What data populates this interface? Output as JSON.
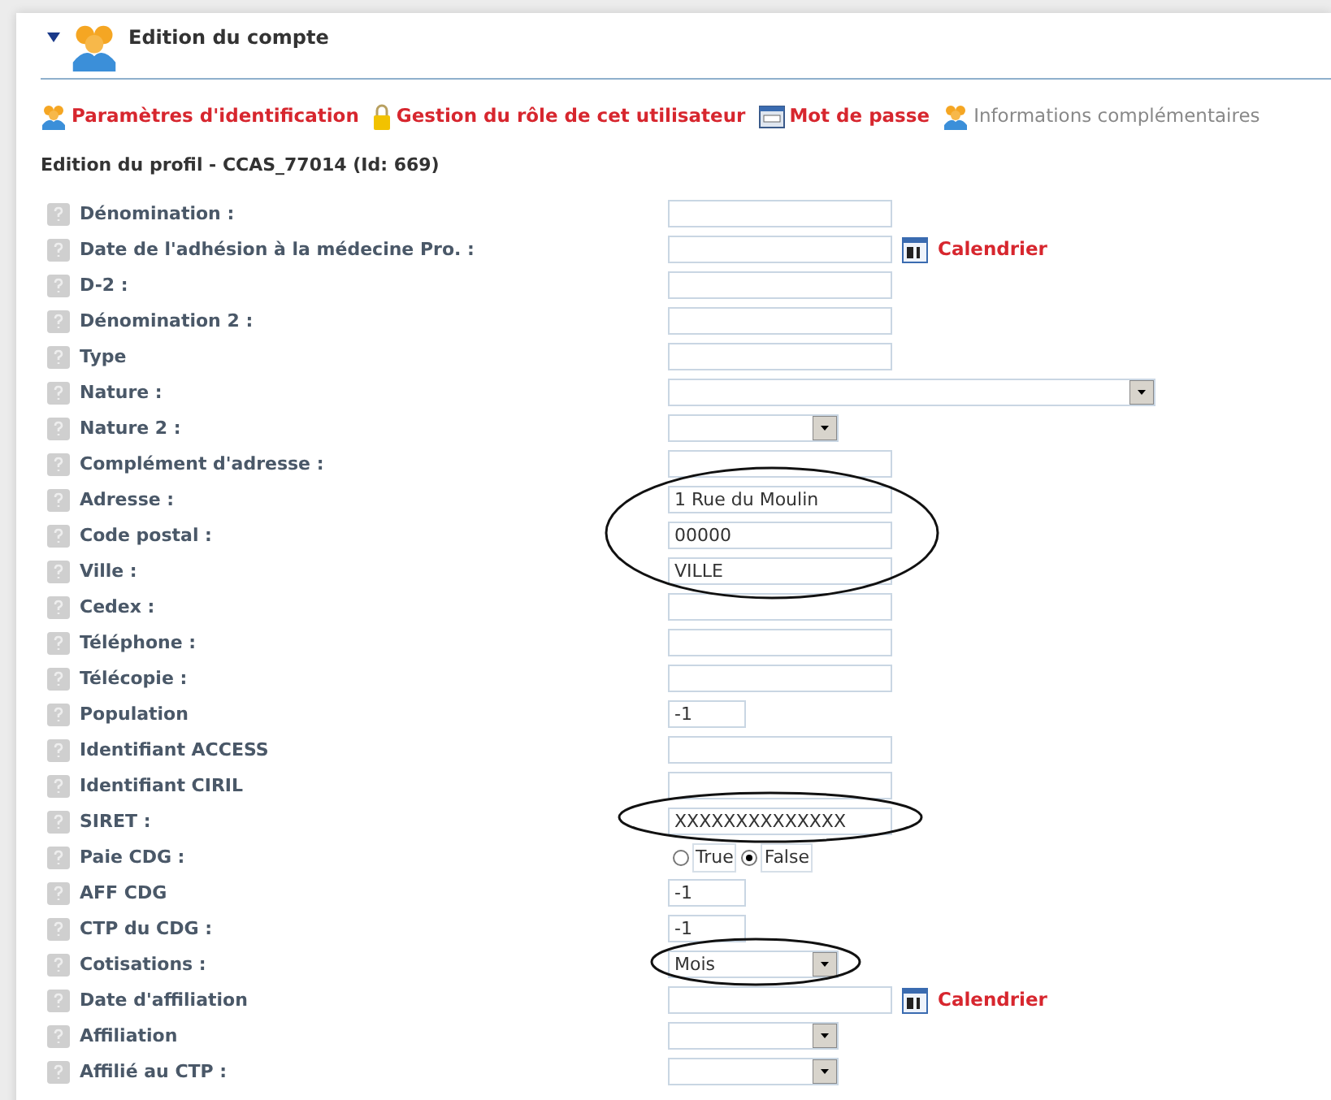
{
  "panel": {
    "title": "Edition du compte",
    "expanded": true
  },
  "links": [
    {
      "kind": "users",
      "label": "Paramètres d'identification",
      "disabled": false
    },
    {
      "kind": "lock",
      "label": "Gestion du rôle de cet utilisateur",
      "disabled": false
    },
    {
      "kind": "password",
      "label": "Mot de passe",
      "disabled": false
    },
    {
      "kind": "users",
      "label": "Informations complémentaires",
      "disabled": true
    }
  ],
  "profile_heading": "Edition du profil - CCAS_77014 (Id: 669)",
  "fields": [
    {
      "label": "Dénomination :",
      "kind": "text"
    },
    {
      "label": "Date de l'adhésion à la médecine Pro. :",
      "kind": "date",
      "link": "Calendrier"
    },
    {
      "label": "D-2 :",
      "kind": "text"
    },
    {
      "label": "Dénomination 2 :",
      "kind": "text"
    },
    {
      "label": "Type",
      "kind": "text"
    },
    {
      "label": "Nature :",
      "kind": "select-wide"
    },
    {
      "label": "Nature 2 :",
      "kind": "select"
    },
    {
      "label": "Complément d'adresse :",
      "kind": "text"
    },
    {
      "label": "Adresse :",
      "kind": "text",
      "value": "1 Rue du Moulin"
    },
    {
      "label": "Code postal :",
      "kind": "text",
      "value": "00000"
    },
    {
      "label": "Ville :",
      "kind": "text",
      "value": "VILLE"
    },
    {
      "label": "Cedex :",
      "kind": "text"
    },
    {
      "label": "Téléphone :",
      "kind": "text"
    },
    {
      "label": "Télécopie :",
      "kind": "text"
    },
    {
      "label": "Population",
      "kind": "short",
      "value": "-1"
    },
    {
      "label": "Identifiant ACCESS",
      "kind": "text"
    },
    {
      "label": "Identifiant CIRIL",
      "kind": "text"
    },
    {
      "label": "SIRET :",
      "kind": "text",
      "value": "XXXXXXXXXXXXXX"
    },
    {
      "label": "Paie CDG :",
      "kind": "radio",
      "options": [
        {
          "label": "True",
          "selected": false
        },
        {
          "label": "False",
          "selected": true
        }
      ]
    },
    {
      "label": "AFF CDG",
      "kind": "short",
      "value": "-1"
    },
    {
      "label": "CTP du CDG :",
      "kind": "short",
      "value": "-1"
    },
    {
      "label": "Cotisations :",
      "kind": "select",
      "value": "Mois"
    },
    {
      "label": "Date d'affiliation",
      "kind": "date",
      "link": "Calendrier"
    },
    {
      "label": "Affiliation",
      "kind": "select"
    },
    {
      "label": "Affilié au CTP :",
      "kind": "select"
    }
  ]
}
